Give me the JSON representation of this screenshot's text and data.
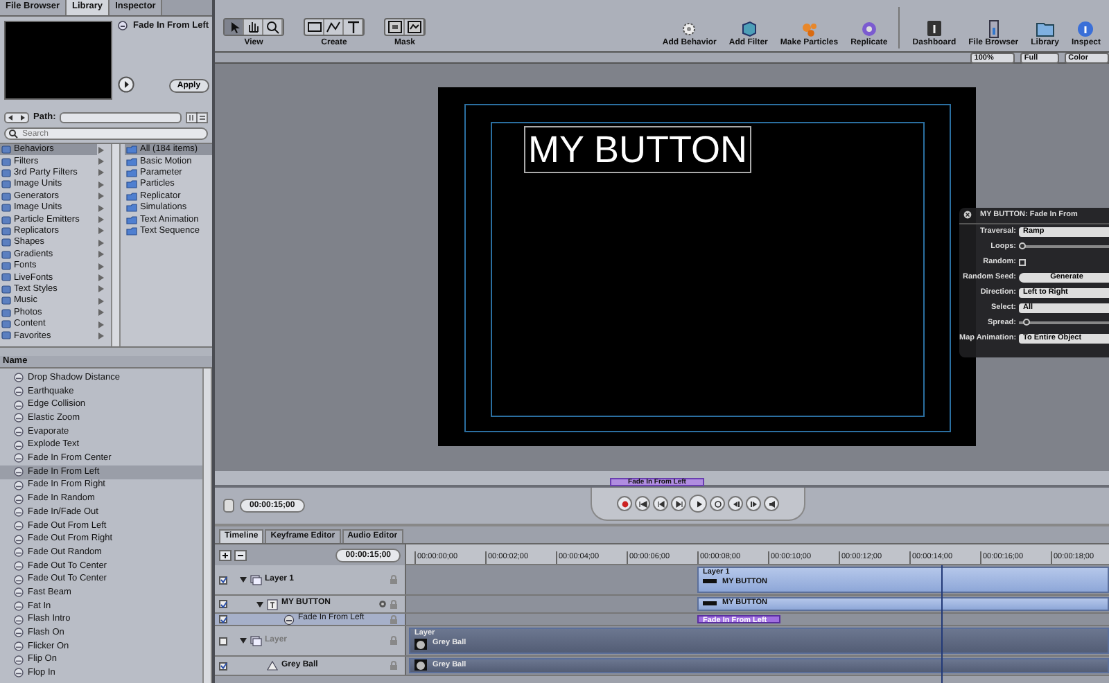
{
  "panel_tabs": [
    {
      "label": "File Browser",
      "selected": false
    },
    {
      "label": "Library",
      "selected": true
    },
    {
      "label": "Inspector",
      "selected": false
    }
  ],
  "preview": {
    "title": "Fade In From Left",
    "apply": "Apply"
  },
  "path": {
    "label": "Path:"
  },
  "search": {
    "placeholder": "Search"
  },
  "categories": [
    {
      "label": "Behaviors",
      "selected": true
    },
    {
      "label": "Filters",
      "selected": false
    },
    {
      "label": "3rd Party Filters",
      "selected": false
    },
    {
      "label": "Image Units",
      "selected": false
    },
    {
      "label": "Generators",
      "selected": false
    },
    {
      "label": "Image Units",
      "selected": false
    },
    {
      "label": "Particle Emitters",
      "selected": false
    },
    {
      "label": "Replicators",
      "selected": false
    },
    {
      "label": "Shapes",
      "selected": false
    },
    {
      "label": "Gradients",
      "selected": false
    },
    {
      "label": "Fonts",
      "selected": false
    },
    {
      "label": "LiveFonts",
      "selected": false
    },
    {
      "label": "Text Styles",
      "selected": false
    },
    {
      "label": "Music",
      "selected": false
    },
    {
      "label": "Photos",
      "selected": false
    },
    {
      "label": "Content",
      "selected": false
    },
    {
      "label": "Favorites",
      "selected": false
    }
  ],
  "subcategories": [
    {
      "label": "All (184 items)",
      "selected": true
    },
    {
      "label": "Basic Motion",
      "selected": false
    },
    {
      "label": "Parameter",
      "selected": false
    },
    {
      "label": "Particles",
      "selected": false
    },
    {
      "label": "Replicator",
      "selected": false
    },
    {
      "label": "Simulations",
      "selected": false
    },
    {
      "label": "Text Animation",
      "selected": false
    },
    {
      "label": "Text Sequence",
      "selected": false
    }
  ],
  "list": {
    "header": "Name",
    "items": [
      {
        "label": "Drop Shadow Distance",
        "selected": false
      },
      {
        "label": "Earthquake",
        "selected": false
      },
      {
        "label": "Edge Collision",
        "selected": false
      },
      {
        "label": "Elastic Zoom",
        "selected": false
      },
      {
        "label": "Evaporate",
        "selected": false
      },
      {
        "label": "Explode Text",
        "selected": false
      },
      {
        "label": "Fade In From Center",
        "selected": false
      },
      {
        "label": "Fade In From Left",
        "selected": true
      },
      {
        "label": "Fade In From Right",
        "selected": false
      },
      {
        "label": "Fade In Random",
        "selected": false
      },
      {
        "label": "Fade In/Fade Out",
        "selected": false
      },
      {
        "label": "Fade Out From Left",
        "selected": false
      },
      {
        "label": "Fade Out From Right",
        "selected": false
      },
      {
        "label": "Fade Out Random",
        "selected": false
      },
      {
        "label": "Fade Out To Center",
        "selected": false
      },
      {
        "label": "Fade Out To Center",
        "selected": false
      },
      {
        "label": "Fast Beam",
        "selected": false
      },
      {
        "label": "Fat In",
        "selected": false
      },
      {
        "label": "Flash Intro",
        "selected": false
      },
      {
        "label": "Flash On",
        "selected": false
      },
      {
        "label": "Flicker On",
        "selected": false
      },
      {
        "label": "Flip On",
        "selected": false
      },
      {
        "label": "Flop In",
        "selected": false
      }
    ]
  },
  "toolbar": {
    "groups": [
      {
        "label": "View",
        "tools": [
          {
            "kind": "arrow",
            "selected": true
          },
          {
            "kind": "hand",
            "selected": false
          },
          {
            "kind": "zoom",
            "selected": false
          }
        ]
      },
      {
        "label": "Create",
        "tools": [
          {
            "kind": "rect",
            "selected": false
          },
          {
            "kind": "bezier",
            "selected": false
          },
          {
            "kind": "text",
            "selected": false
          }
        ]
      },
      {
        "label": "Mask",
        "tools": [
          {
            "kind": "mask-rect",
            "selected": false
          },
          {
            "kind": "mask-bezier",
            "selected": false
          }
        ]
      }
    ],
    "actions": [
      {
        "label": "Add Behavior",
        "kind": "gear"
      },
      {
        "label": "Add Filter",
        "kind": "filter"
      },
      {
        "label": "Make Particles",
        "kind": "particles"
      },
      {
        "label": "Replicate",
        "kind": "replicate"
      },
      {
        "label": "Dashboard",
        "kind": "dashboard"
      },
      {
        "label": "File Browser",
        "kind": "browser"
      },
      {
        "label": "Library",
        "kind": "library"
      },
      {
        "label": "Inspect",
        "kind": "inspector"
      }
    ]
  },
  "view_options": [
    "100%",
    "Full",
    "Color"
  ],
  "canvas": {
    "text": "MY BUTTON"
  },
  "hud": {
    "title": "MY BUTTON: Fade In From",
    "rows": [
      {
        "kind": "select",
        "label": "Traversal:",
        "value": "Ramp"
      },
      {
        "kind": "slider",
        "label": "Loops:",
        "level": 0.0
      },
      {
        "kind": "checkbox",
        "label": "Random:",
        "checked": false
      },
      {
        "kind": "button",
        "label": "Random Seed:",
        "value": "Generate"
      },
      {
        "kind": "select",
        "label": "Direction:",
        "value": "Left to Right"
      },
      {
        "kind": "select",
        "label": "Select:",
        "value": "All"
      },
      {
        "kind": "slider",
        "label": "Spread:",
        "level": 0.05
      },
      {
        "kind": "select",
        "label": "Map Animation:",
        "value": "To Entire Object"
      }
    ]
  },
  "mini_timeline": {
    "clip": "Fade In From Left"
  },
  "transport": {
    "timecode": "00:00:15;00",
    "buttons": [
      {
        "kind": "record"
      },
      {
        "kind": "start"
      },
      {
        "kind": "back"
      },
      {
        "kind": "step"
      },
      {
        "kind": "play"
      },
      {
        "kind": "loop"
      },
      {
        "kind": "in"
      },
      {
        "kind": "out"
      },
      {
        "kind": "audio"
      }
    ]
  },
  "timeline": {
    "tabs": [
      {
        "label": "Timeline",
        "selected": true
      },
      {
        "label": "Keyframe Editor",
        "selected": false
      },
      {
        "label": "Audio Editor",
        "selected": false
      }
    ],
    "timecode": "00:00:15;00",
    "ticks": [
      "00:00:00;00",
      "00:00:02;00",
      "00:00:04;00",
      "00:00:06;00",
      "00:00:08;00",
      "00:00:10;00",
      "00:00:12;00",
      "00:00:14;00",
      "00:00:16;00",
      "00:00:18;00"
    ],
    "layers": [
      {
        "name": "Layer 1",
        "kind": "group",
        "enabled": true,
        "expanded": true,
        "selected": false,
        "track": {
          "title": "Layer 1",
          "label": "MY BUTTON",
          "kind": "offset"
        },
        "children": [
          {
            "name": "MY BUTTON",
            "kind": "text",
            "enabled": true,
            "expanded": true,
            "selected": false,
            "track": {
              "label": "MY BUTTON",
              "kind": "offset"
            },
            "children": [
              {
                "name": "Fade In From Left",
                "kind": "behavior",
                "enabled": true,
                "selected": true,
                "track": {
                  "label": "Fade In From Left",
                  "kind": "offset"
                }
              }
            ]
          }
        ]
      },
      {
        "name": "Layer",
        "kind": "group",
        "enabled": false,
        "expanded": true,
        "selected": false,
        "track": {
          "title": "Layer",
          "label": "Grey Ball",
          "kind": "full"
        },
        "children": [
          {
            "name": "Grey Ball",
            "kind": "shape",
            "enabled": true,
            "selected": false,
            "track": {
              "label": "Grey Ball",
              "kind": "full"
            }
          }
        ]
      }
    ]
  }
}
